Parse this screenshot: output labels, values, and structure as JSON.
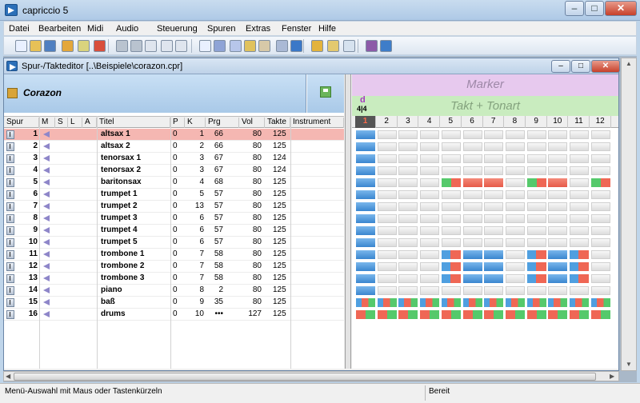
{
  "app": {
    "title": "capriccio 5"
  },
  "menu": [
    "Datei",
    "Bearbeiten",
    "Midi",
    "Audio",
    "Steuerung",
    "Spuren",
    "Extras",
    "Fenster",
    "Hilfe"
  ],
  "toolbar_icons": [
    "new-icon",
    "open-icon",
    "save-icon",
    "save-as-icon",
    "print-icon",
    "export-icon",
    "undo-icon",
    "redo-icon",
    "cut-icon",
    "copy-icon",
    "paste-icon",
    "track-editor-icon",
    "piano-roll-icon",
    "score-icon",
    "drum-editor-icon",
    "mixer-icon",
    "audio-icon",
    "midi-icon",
    "settings-icon",
    "notes-icon",
    "list-icon",
    "quantize-icon",
    "help-icon"
  ],
  "editor": {
    "title": "Spur-/Takteditor [..\\Beispiele\\corazon.cpr]",
    "song": "Corazon"
  },
  "columns": {
    "spur": "Spur",
    "m": "M",
    "s": "S",
    "l": "L",
    "a": "A",
    "titel": "Titel",
    "p": "P",
    "k": "K",
    "prg": "Prg",
    "vol": "Vol",
    "takte": "Takte",
    "instrument": "Instrument"
  },
  "tracks": [
    {
      "num": "1",
      "title": "altsax 1",
      "p": "0",
      "k": "1",
      "prg": "66",
      "vol": "80",
      "takte": "125"
    },
    {
      "num": "2",
      "title": "altsax 2",
      "p": "0",
      "k": "2",
      "prg": "66",
      "vol": "80",
      "takte": "125"
    },
    {
      "num": "3",
      "title": "tenorsax 1",
      "p": "0",
      "k": "3",
      "prg": "67",
      "vol": "80",
      "takte": "124"
    },
    {
      "num": "4",
      "title": "tenorsax 2",
      "p": "0",
      "k": "3",
      "prg": "67",
      "vol": "80",
      "takte": "124"
    },
    {
      "num": "5",
      "title": "baritonsax",
      "p": "0",
      "k": "4",
      "prg": "68",
      "vol": "80",
      "takte": "125"
    },
    {
      "num": "6",
      "title": "trumpet 1",
      "p": "0",
      "k": "5",
      "prg": "57",
      "vol": "80",
      "takte": "125"
    },
    {
      "num": "7",
      "title": "trumpet 2",
      "p": "0",
      "k": "13",
      "prg": "57",
      "vol": "80",
      "takte": "125"
    },
    {
      "num": "8",
      "title": "trumpet 3",
      "p": "0",
      "k": "6",
      "prg": "57",
      "vol": "80",
      "takte": "125"
    },
    {
      "num": "9",
      "title": "trumpet 4",
      "p": "0",
      "k": "6",
      "prg": "57",
      "vol": "80",
      "takte": "125"
    },
    {
      "num": "10",
      "title": "trumpet 5",
      "p": "0",
      "k": "6",
      "prg": "57",
      "vol": "80",
      "takte": "125"
    },
    {
      "num": "11",
      "title": "trombone 1",
      "p": "0",
      "k": "7",
      "prg": "58",
      "vol": "80",
      "takte": "125"
    },
    {
      "num": "12",
      "title": "trombone 2",
      "p": "0",
      "k": "7",
      "prg": "58",
      "vol": "80",
      "takte": "125"
    },
    {
      "num": "13",
      "title": "trombone 3",
      "p": "0",
      "k": "7",
      "prg": "58",
      "vol": "80",
      "takte": "125"
    },
    {
      "num": "14",
      "title": "piano",
      "p": "0",
      "k": "8",
      "prg": "2",
      "vol": "80",
      "takte": "125"
    },
    {
      "num": "15",
      "title": "baß",
      "p": "0",
      "k": "9",
      "prg": "35",
      "vol": "80",
      "takte": "125"
    },
    {
      "num": "16",
      "title": "drums",
      "p": "0",
      "k": "10",
      "prg": "•••",
      "vol": "127",
      "takte": "125"
    }
  ],
  "marker": "Marker",
  "takt_tonart": "Takt + Tonart",
  "key": "d",
  "meter": "4|4",
  "bars": [
    "1",
    "2",
    "3",
    "4",
    "5",
    "6",
    "7",
    "8",
    "9",
    "10",
    "11",
    "12"
  ],
  "grid": [
    "B...........",
    "B...........",
    "B...........",
    "B...........",
    "B...GRR.GR.G",
    "B...........",
    "B...........",
    "B...........",
    "B...........",
    "B...........",
    "B...XBB.XBX.",
    "B...XBB.XBX.",
    "B...XBB.XBX.",
    "B...........",
    "QQQQQQQQQQQQ",
    "DDDDDDDDDDDD"
  ],
  "status": {
    "left": "Menü-Auswahl mit Maus oder Tastenkürzeln",
    "right": "Bereit"
  }
}
